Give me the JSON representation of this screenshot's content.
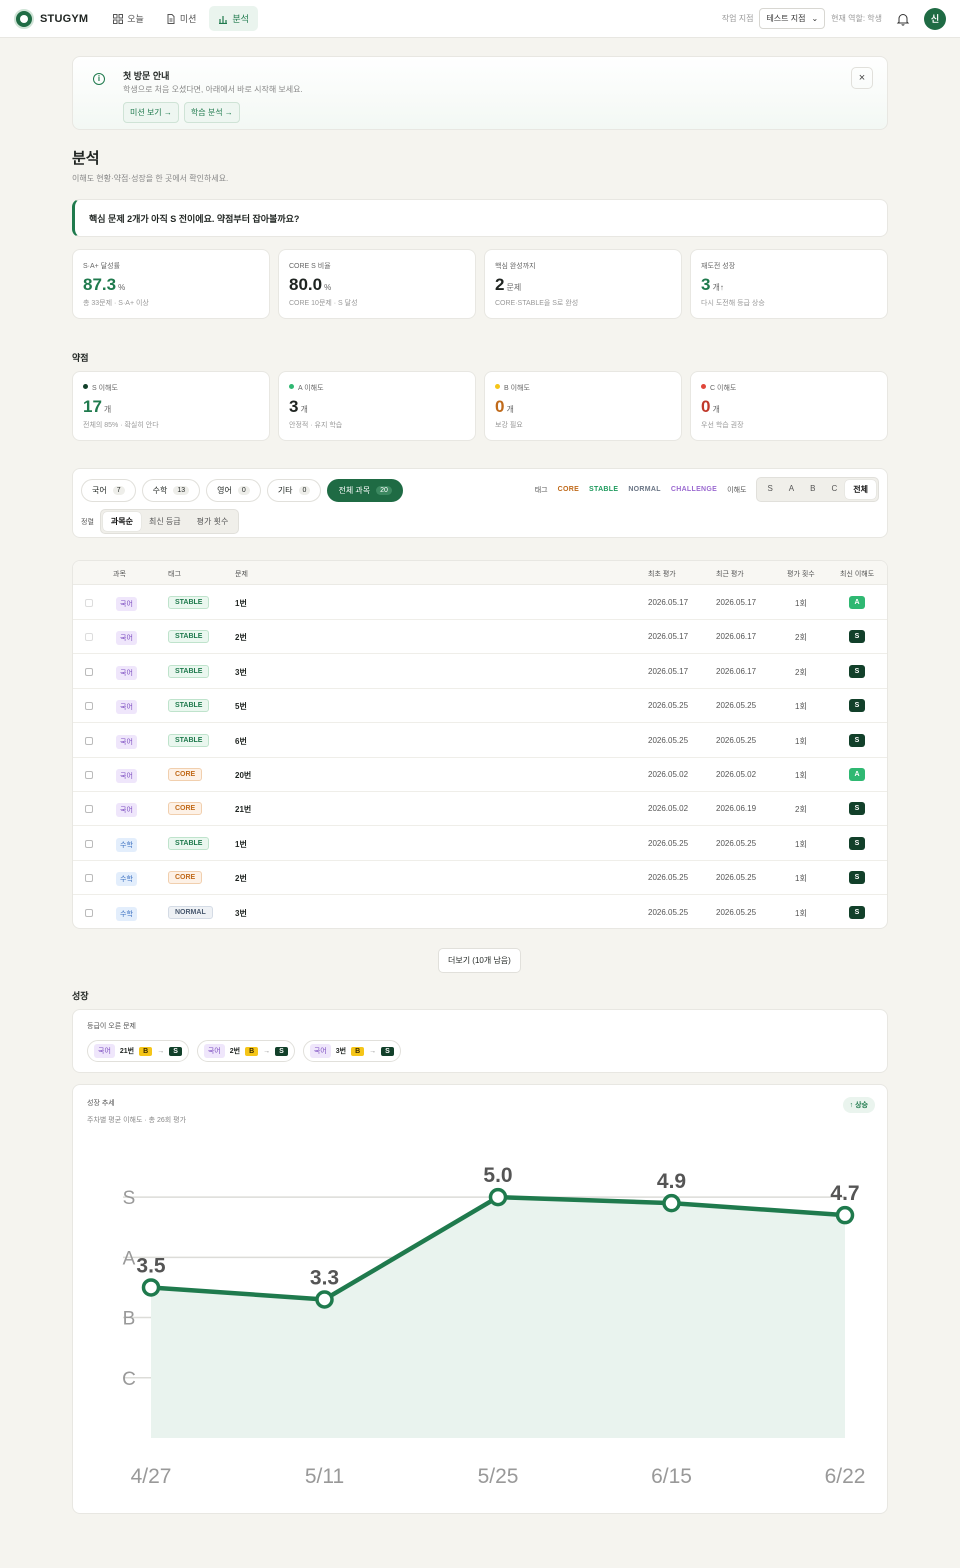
{
  "header": {
    "brand": "STUGYM",
    "nav": [
      {
        "label": "오늘",
        "icon": "grid-icon"
      },
      {
        "label": "미션",
        "icon": "document-icon"
      },
      {
        "label": "분석",
        "icon": "bar-chart-icon",
        "active": true
      }
    ],
    "branch_label": "작업 지점",
    "branch_value": "테스트 지점",
    "role_label": "현재 역할: 학생",
    "avatar": "신"
  },
  "notice": {
    "title": "첫 방문 안내",
    "desc": "학생으로 처음 오셨다면, 아래에서 바로 시작해 보세요.",
    "btn1": "미션 보기 →",
    "btn2": "학습 분석 →",
    "close": "×"
  },
  "page": {
    "title": "분석",
    "subtitle": "이해도 현황·약점·성장을 한 곳에서 확인하세요.",
    "alert": "핵심 문제 2개가 아직 S 전이에요. 약점부터 잡아볼까요?"
  },
  "stats": [
    {
      "label": "S·A+ 달성률",
      "value": "87.3",
      "unit": "%",
      "note": "총 33문제 · S·A+ 이상",
      "color": "#1f7a4d"
    },
    {
      "label": "CORE S 비율",
      "value": "80.0",
      "unit": "%",
      "note": "CORE 10문제 · S 달성",
      "color": "#1f2421"
    },
    {
      "label": "핵심 완성까지",
      "value": "2",
      "unit": "문제",
      "note": "CORE·STABLE을 S로 완성",
      "color": "#1f2421"
    },
    {
      "label": "재도전 성장",
      "value": "3",
      "unit": "개↑",
      "note": "다시 도전해 등급 상승",
      "color": "#1f7a4d"
    }
  ],
  "weak_title": "약점",
  "levels": [
    {
      "label": "S 이해도",
      "value": "17",
      "unit": "개",
      "note": "전체의 85% · 확실히 안다",
      "dot": "#12402a",
      "color": "#1f7a4d"
    },
    {
      "label": "A 이해도",
      "value": "3",
      "unit": "개",
      "note": "안정적 · 유지 학습",
      "dot": "#2fb872",
      "color": "#1f2421"
    },
    {
      "label": "B 이해도",
      "value": "0",
      "unit": "개",
      "note": "보강 필요",
      "dot": "#f5c518",
      "color": "#c06a1a"
    },
    {
      "label": "C 이해도",
      "value": "0",
      "unit": "개",
      "note": "우선 학습 권장",
      "dot": "#e0473a",
      "color": "#c0392b"
    }
  ],
  "filters": {
    "subjects": [
      {
        "label": "국어",
        "count": "7"
      },
      {
        "label": "수학",
        "count": "13"
      },
      {
        "label": "영어",
        "count": "0"
      },
      {
        "label": "기타",
        "count": "0"
      },
      {
        "label": "전체 과목",
        "count": "20",
        "active": true
      }
    ],
    "tag_label": "태그",
    "tags": [
      {
        "label": "CORE",
        "color": "#c06a1a"
      },
      {
        "label": "STABLE",
        "color": "#1f9a5d"
      },
      {
        "label": "NORMAL",
        "color": "#6a7585"
      },
      {
        "label": "CHALLENGE",
        "color": "#9b6ad0"
      }
    ],
    "level_label": "이해도",
    "levels": [
      "S",
      "A",
      "B",
      "C",
      "전체"
    ],
    "sort_label": "정렬",
    "sorts": [
      "과목순",
      "최신 등급",
      "평가 횟수"
    ]
  },
  "table": {
    "headers": [
      "과목",
      "태그",
      "문제",
      "최초 평가",
      "최근 평가",
      "평가 횟수",
      "최신 이해도"
    ],
    "rows": [
      {
        "subject": "국어",
        "tag": "STABLE",
        "problem": "1번",
        "first": "2026.05.17",
        "last": "2026.05.17",
        "count": "1회",
        "level": "A"
      },
      {
        "subject": "국어",
        "tag": "STABLE",
        "problem": "2번",
        "first": "2026.05.17",
        "last": "2026.06.17",
        "count": "2회",
        "level": "S"
      },
      {
        "subject": "국어",
        "tag": "STABLE",
        "problem": "3번",
        "first": "2026.05.17",
        "last": "2026.06.17",
        "count": "2회",
        "level": "S"
      },
      {
        "subject": "국어",
        "tag": "STABLE",
        "problem": "5번",
        "first": "2026.05.25",
        "last": "2026.05.25",
        "count": "1회",
        "level": "S"
      },
      {
        "subject": "국어",
        "tag": "STABLE",
        "problem": "6번",
        "first": "2026.05.25",
        "last": "2026.05.25",
        "count": "1회",
        "level": "S"
      },
      {
        "subject": "국어",
        "tag": "CORE",
        "problem": "20번",
        "first": "2026.05.02",
        "last": "2026.05.02",
        "count": "1회",
        "level": "A"
      },
      {
        "subject": "국어",
        "tag": "CORE",
        "problem": "21번",
        "first": "2026.05.02",
        "last": "2026.06.19",
        "count": "2회",
        "level": "S"
      },
      {
        "subject": "수학",
        "tag": "STABLE",
        "problem": "1번",
        "first": "2026.05.25",
        "last": "2026.05.25",
        "count": "1회",
        "level": "S"
      },
      {
        "subject": "수학",
        "tag": "CORE",
        "problem": "2번",
        "first": "2026.05.25",
        "last": "2026.05.25",
        "count": "1회",
        "level": "S"
      },
      {
        "subject": "수학",
        "tag": "NORMAL",
        "problem": "3번",
        "first": "2026.05.25",
        "last": "2026.05.25",
        "count": "1회",
        "level": "S"
      }
    ],
    "more": "더보기 (10개 남음)"
  },
  "growth": {
    "title": "성장",
    "risen_label": "등급이 오른 문제",
    "risen": [
      {
        "subject": "국어",
        "problem": "21번",
        "from": "B",
        "to": "S"
      },
      {
        "subject": "국어",
        "problem": "2번",
        "from": "B",
        "to": "S"
      },
      {
        "subject": "국어",
        "problem": "3번",
        "from": "B",
        "to": "S"
      }
    ],
    "trend_label": "성장 추세",
    "trend_sub": "주차별 평균 이해도 · 총 26회 평가",
    "trend_badge": "↑ 상승"
  },
  "chart_data": {
    "type": "area",
    "categories": [
      "4/27",
      "5/11",
      "5/25",
      "6/15",
      "6/22"
    ],
    "values": [
      3.5,
      3.3,
      5.0,
      4.9,
      4.7
    ],
    "y_ticks": [
      {
        "label": "S",
        "value": 5
      },
      {
        "label": "A",
        "value": 4
      },
      {
        "label": "B",
        "value": 3
      },
      {
        "label": "C",
        "value": 2
      }
    ],
    "ylim": [
      1,
      5.5
    ],
    "grid": true,
    "color": "#1f7a4d",
    "title": "",
    "xlabel": "",
    "ylabel": ""
  }
}
